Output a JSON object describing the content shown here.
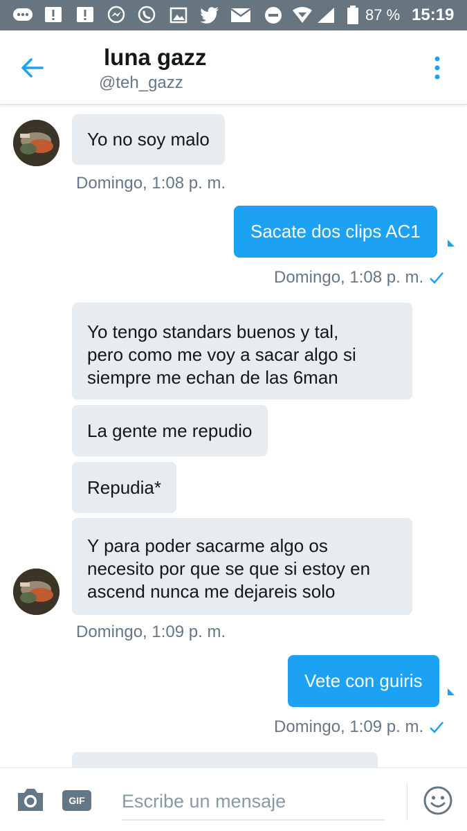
{
  "status_bar": {
    "battery": "87 %",
    "time": "15:19",
    "icons": [
      "message-dots-icon",
      "alert-icon",
      "alert-icon",
      "messenger-icon",
      "whatsapp-icon",
      "gallery-icon",
      "twitter-icon",
      "mail-icon",
      "dnd-icon",
      "wifi-icon",
      "signal-icon",
      "battery-icon"
    ]
  },
  "header": {
    "name": "luna gazz",
    "handle": "@teh_gazz"
  },
  "messages": [
    {
      "dir": "in",
      "text": "Yo no soy malo"
    },
    {
      "time": "Domingo, 1:08 p. m."
    },
    {
      "dir": "out",
      "text": "Sacate dos clips AC1"
    },
    {
      "time": "Domingo, 1:08 p. m."
    },
    {
      "dir": "in",
      "lines": [
        "Yo tengo standars buenos y tal,",
        "pero como me voy a sacar algo si",
        "siempre me echan de las 6man"
      ]
    },
    {
      "dir": "in",
      "text": "La gente me repudio"
    },
    {
      "dir": "in",
      "text": "Repudia*"
    },
    {
      "dir": "in",
      "lines": [
        "Y para poder sacarme algo os",
        "necesito por que se que si estoy en",
        "ascend nunca me dejareis solo"
      ]
    },
    {
      "time": "Domingo, 1:09 p. m."
    },
    {
      "dir": "out",
      "text": "Vete con guiris"
    },
    {
      "time": "Domingo, 1:09 p. m."
    }
  ],
  "composer": {
    "placeholder": "Escribe un mensaje",
    "gif_label": "GIF"
  },
  "colors": {
    "accent": "#1da1f2",
    "status_bar": "#66757f",
    "incoming_bubble": "#e6ecf0"
  }
}
